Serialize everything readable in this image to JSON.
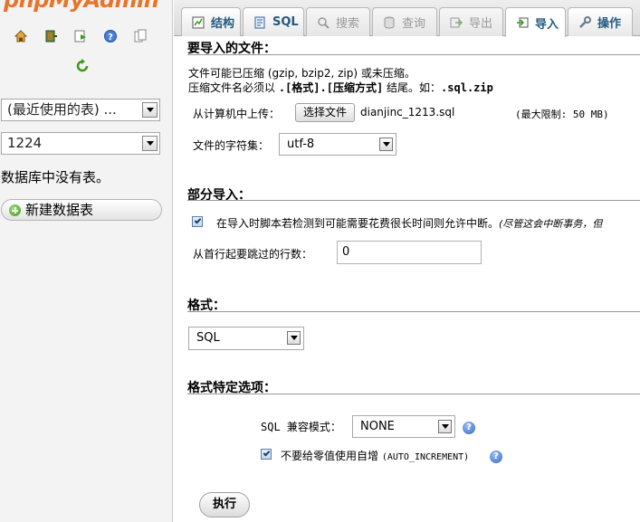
{
  "nav": {
    "logo_prefix": "php",
    "logo_main": "MyAdmin",
    "icons": [
      "home-icon",
      "exit-icon",
      "query-window-icon",
      "docs-icon",
      "documentation-icon",
      "reload-icon"
    ],
    "recent_tables_select": "(最近使用的表) ...",
    "database_select": "1224",
    "no_tables_text": "数据库中没有表。",
    "new_table_button": "新建数据表"
  },
  "tabs": [
    {
      "label": "结构",
      "icon": "structure-icon",
      "state": "normal"
    },
    {
      "label": "SQL",
      "icon": "sql-icon",
      "state": "normal"
    },
    {
      "label": "搜索",
      "icon": "search-icon",
      "state": "disabled"
    },
    {
      "label": "查询",
      "icon": "query-icon",
      "state": "disabled"
    },
    {
      "label": "导出",
      "icon": "export-icon",
      "state": "disabled"
    },
    {
      "label": "导入",
      "icon": "import-icon",
      "state": "active"
    },
    {
      "label": "操作",
      "icon": "operations-icon",
      "state": "normal"
    }
  ],
  "import_file": {
    "title": "要导入的文件：",
    "compress_line1": "文件可能已压缩 (gzip, bzip2, zip) 或未压缩。",
    "compress_line2_a": "压缩文件名必须以",
    "compress_line2_b": ".[格式].[压缩方式]",
    "compress_line2_c": "结尾。如：",
    "compress_line2_d": ".sql.zip",
    "upload_label": "从计算机中上传：",
    "choose_file_button": "选择文件",
    "file_name": "dianjinc_1213.sql",
    "max_limit": "(最大限制: 50 MB)",
    "charset_label": "文件的字符集：",
    "charset_value": "utf-8"
  },
  "partial_import": {
    "title": "部分导入：",
    "allow_interrupt_label": "在导入时脚本若检测到可能需要花费很长时间则允许中断。",
    "allow_interrupt_note": "(尽管这会中断事务，",
    "allow_interrupt_note_tail": "但",
    "allow_interrupt_checked": true,
    "skip_label": "从首行起要跳过的行数：",
    "skip_value": "0"
  },
  "format": {
    "title": "格式：",
    "value": "SQL"
  },
  "format_options": {
    "title": "格式特定选项：",
    "compat_label": "SQL 兼容模式：",
    "compat_value": "NONE",
    "auto_inc_label": "不要给零值使用自增",
    "auto_inc_code": "(AUTO_INCREMENT)",
    "auto_inc_checked": true
  },
  "go_button": "执行",
  "colors": {
    "tab_text": "#235a81",
    "logo": "#e8742a"
  }
}
